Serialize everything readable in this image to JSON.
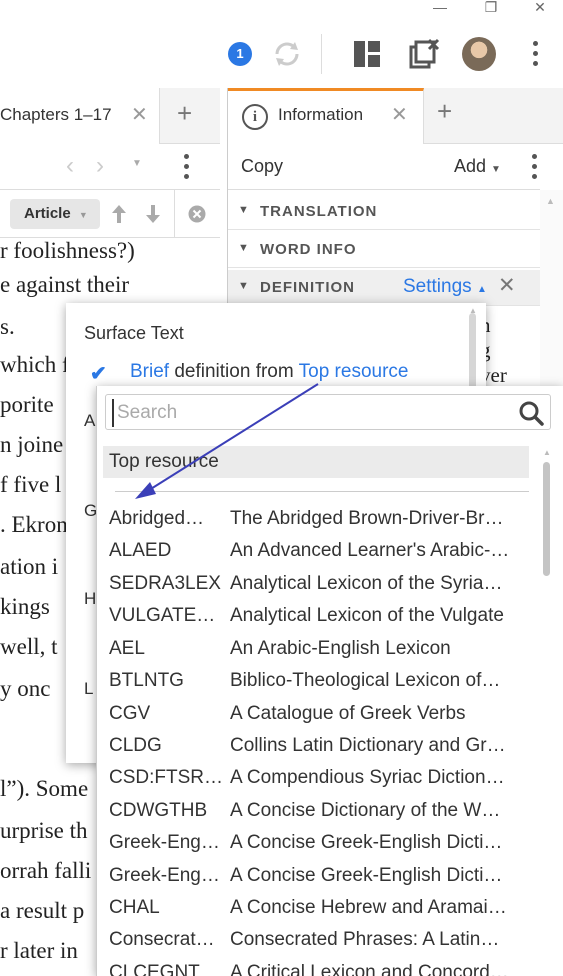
{
  "window": {
    "minimize": "—",
    "restore": "❐",
    "close": "✕"
  },
  "toolbar": {
    "notification_count": "1"
  },
  "left_panel": {
    "tab_title": "Chapters 1–17",
    "article_button": "Article",
    "lines": [
      "r foolishness?)",
      "e  against  their",
      "s.",
      "which f",
      "porite",
      "n joine",
      "f five l",
      ". Ekron",
      "ation i",
      "kings",
      "well, t",
      "y  onc",
      "",
      "l”).  Some",
      "urprise th",
      "orrah falli",
      "a result p",
      "r later in"
    ]
  },
  "info_panel": {
    "tab_title": "Information",
    "copy": "Copy",
    "add": "Add",
    "sections": [
      "TRANSLATION",
      "WORD INFO",
      "DEFINITION"
    ],
    "settings": "Settings",
    "peek_texts": [
      "n",
      "g",
      "ver"
    ]
  },
  "settings_popup": {
    "surface_text": "Surface Text",
    "brief": "Brief",
    "definition_from": "definition from",
    "top_resource": "Top resource",
    "side_letters": [
      "A",
      "G",
      "H",
      "L"
    ]
  },
  "dropdown": {
    "search_placeholder": "Search",
    "top_resource": "Top resource",
    "items": [
      {
        "abbr": "Abridged…",
        "name": "The Abridged Brown-Driver-Br…"
      },
      {
        "abbr": "ALAED",
        "name": "An Advanced Learner's Arabic-…"
      },
      {
        "abbr": "SEDRA3LEX",
        "name": "Analytical Lexicon of the Syria…"
      },
      {
        "abbr": "VULGATEA…",
        "name": "Analytical Lexicon of the Vulgate"
      },
      {
        "abbr": "AEL",
        "name": "An Arabic-English Lexicon"
      },
      {
        "abbr": "BTLNTG",
        "name": "Biblico-Theological Lexicon of…"
      },
      {
        "abbr": "CGV",
        "name": "A Catalogue of Greek Verbs"
      },
      {
        "abbr": "CLDG",
        "name": "Collins Latin Dictionary and Gr…"
      },
      {
        "abbr": "CSD:FTSRPS",
        "name": "A Compendious Syriac Diction…"
      },
      {
        "abbr": "CDWGTHB",
        "name": "A Concise Dictionary of the W…"
      },
      {
        "abbr": "Greek-Eng…",
        "name": "A Concise Greek-English Dicti…"
      },
      {
        "abbr": "Greek-Eng…",
        "name": "A Concise Greek-English Dicti…"
      },
      {
        "abbr": "CHAL",
        "name": "A Concise Hebrew and Aramai…"
      },
      {
        "abbr": "Consecrat…",
        "name": "Consecrated Phrases: A Latin…"
      },
      {
        "abbr": "CLCEGNT",
        "name": "A Critical Lexicon and Concord…"
      }
    ]
  },
  "colors": {
    "accent": "#2b78e4",
    "tab_active": "#f08a24",
    "arrow": "#3b3fb8"
  }
}
